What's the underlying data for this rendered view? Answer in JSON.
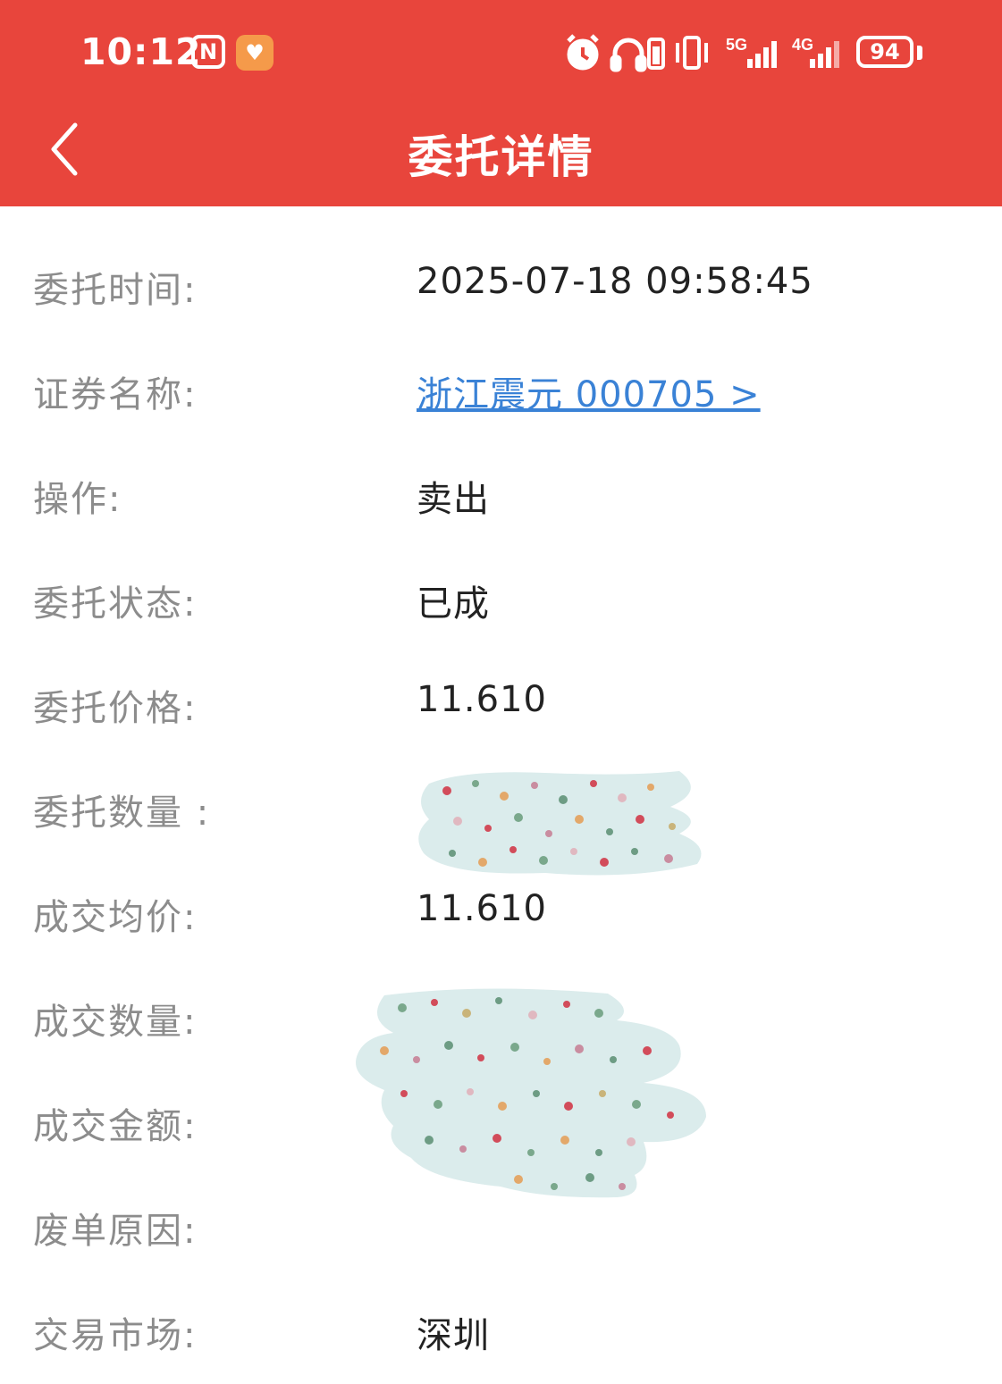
{
  "status_bar": {
    "time": "10:12",
    "nfc_icon": "nfc-icon",
    "health_icon": "heart-icon",
    "network_5g": "5G",
    "network_4g": "4G",
    "battery": "94"
  },
  "header": {
    "title": "委托详情",
    "back_icon": "chevron-left-icon",
    "background": "#e8453c"
  },
  "details": {
    "order_time_label": "委托时间:",
    "order_time_value": "2025-07-18 09:58:45",
    "security_label": "证券名称:",
    "security_value": "浙江震元 000705 >",
    "operation_label": "操作:",
    "operation_value": "卖出",
    "order_status_label": "委托状态:",
    "order_status_value": "已成",
    "order_price_label": "委托价格:",
    "order_price_value": "11.610",
    "order_qty_label": "委托数量 :",
    "avg_price_label": "成交均价:",
    "avg_price_value": "11.610",
    "deal_qty_label": "成交数量:",
    "deal_amount_label": "成交金额:",
    "cancel_reason_label": "废单原因:",
    "market_label": "交易市场:",
    "market_value": "深圳"
  },
  "colors": {
    "accent": "#e8453c",
    "link": "#3a82d6",
    "label": "#8c8c8c",
    "value": "#222222"
  }
}
